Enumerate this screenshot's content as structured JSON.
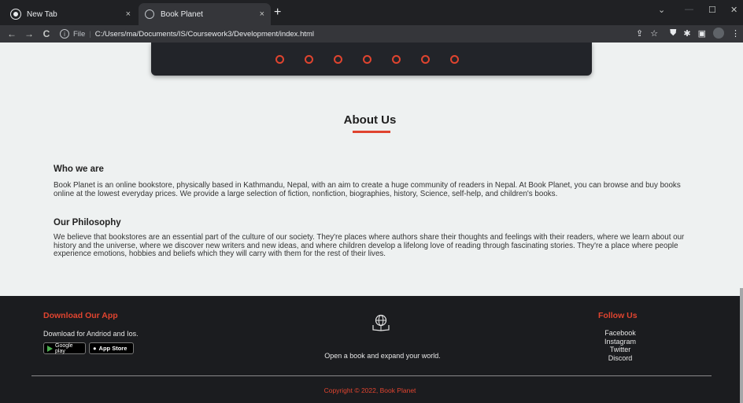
{
  "browser": {
    "tabs": [
      {
        "title": "New Tab",
        "close": "×"
      },
      {
        "title": "Book Planet",
        "close": "×"
      }
    ],
    "new_tab": "+",
    "window_controls": {
      "minimize": "—",
      "maximize": "☐",
      "close": "✕",
      "dropdown": "⌄"
    },
    "nav": {
      "back": "←",
      "forward": "→",
      "reload": "C"
    },
    "address": {
      "scheme_label": "File",
      "url": "C:/Users/ma/Documents/IS/Coursework3/Development/index.html"
    },
    "toolbar_icons": [
      "share-icon",
      "star-icon",
      "shield-icon",
      "extensions-icon",
      "sidebar-icon",
      "profile-avatar",
      "menu-icon"
    ],
    "toolbar_glyphs": {
      "share": "⇪",
      "star": "☆",
      "shield": "⛊",
      "puzzle": "✱",
      "sidebar": "▣",
      "menu": "⋮"
    }
  },
  "slider": {
    "dot_count": 7
  },
  "about": {
    "title": "About Us",
    "sections": [
      {
        "heading": "Who we are",
        "text": "Book Planet is an online bookstore, physically based in Kathmandu, Nepal, with an aim to create a huge community of readers in Nepal. At Book Planet, you can browse and buy books online at the lowest everyday prices. We provide a large selection of fiction, nonfiction, biographies, history, Science, self-help, and children's books."
      },
      {
        "heading": "Our Philosophy",
        "text": "We believe that bookstores are an essential part of the culture of our society. They're places where authors share their thoughts and feelings with their readers, where we learn about our history and the universe, where we discover new writers and new ideas, and where children develop a lifelong love of reading through fascinating stories. They're a place where people experience emotions, hobbies and beliefs which they will carry with them for the rest of their lives."
      }
    ]
  },
  "footer": {
    "download": {
      "heading": "Download Our App",
      "text": "Download for Andriod and Ios.",
      "google_play": "Google play",
      "app_store": "App Store"
    },
    "tagline": "Open a book and expand your world.",
    "follow": {
      "heading": "Follow Us",
      "links": [
        "Facebook",
        "Instagram",
        "Twitter",
        "Discord"
      ]
    },
    "copyright": "Copyright © 2022, Book Planet"
  },
  "colors": {
    "accent": "#e0442f",
    "page_bg": "#eef1f1",
    "footer_bg": "#1b1c1f",
    "dark_box": "#222429"
  }
}
